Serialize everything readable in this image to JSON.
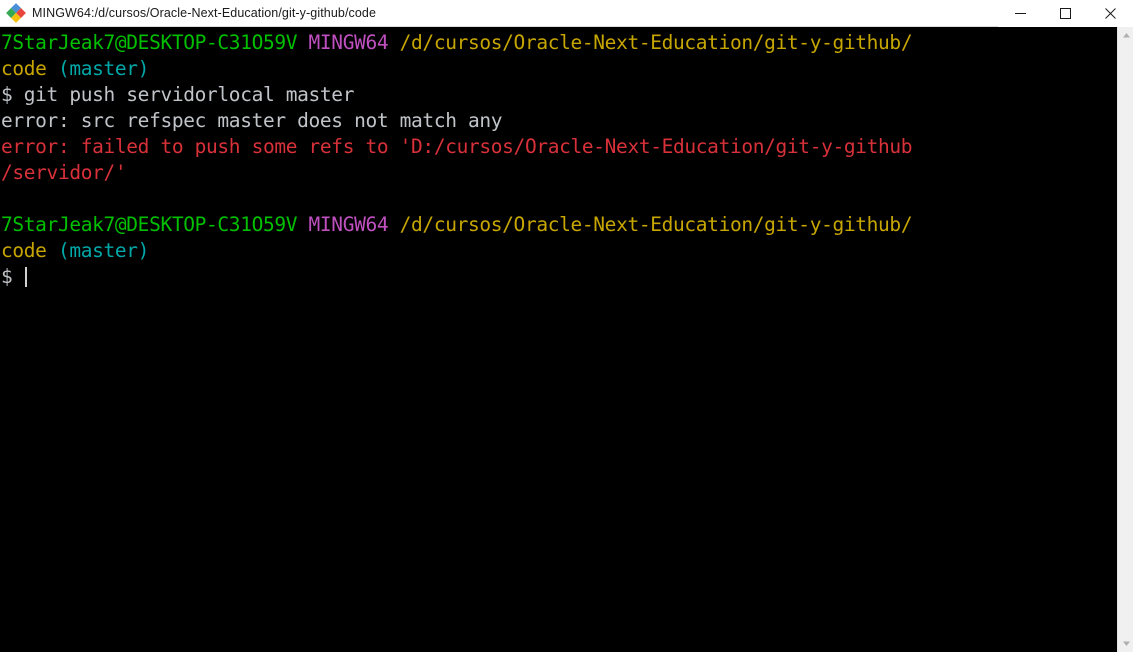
{
  "window": {
    "title": "MINGW64:/d/cursos/Oracle-Next-Education/git-y-github/code",
    "icon": "git-bash-diamond-icon",
    "controls": {
      "minimize": "minimize-icon",
      "maximize": "maximize-icon",
      "close": "close-icon"
    }
  },
  "theme": {
    "background": "#000000",
    "titlebar_background": "#ffffff",
    "foreground": "#c0c4c8",
    "green": "#00a000",
    "magenta": "#c050c0",
    "yellow": "#c7a600",
    "cyan": "#00a8a8",
    "red": "#d8313a",
    "scrollbar": "#f0f0f0"
  },
  "terminal": {
    "prompt": {
      "user_host": "7StarJeak7@DESKTOP-C31O59V",
      "shell": "MINGW64",
      "path_line1": "/d/cursos/Oracle-Next-Education/git-y-github/",
      "path_line2": "code",
      "branch": "(master)",
      "symbol": "$"
    },
    "lines": [
      {
        "id": "prompt-1a",
        "segments": [
          {
            "text": "7StarJeak7@DESKTOP-C31O59V",
            "color": "green"
          },
          {
            "text": " ",
            "color": "text"
          },
          {
            "text": "MINGW64",
            "color": "mingw"
          },
          {
            "text": " ",
            "color": "text"
          },
          {
            "text": "/d/cursos/Oracle-Next-Education/git-y-github/",
            "color": "path"
          }
        ]
      },
      {
        "id": "prompt-1b",
        "segments": [
          {
            "text": "code",
            "color": "path"
          },
          {
            "text": " ",
            "color": "text"
          },
          {
            "text": "(master)",
            "color": "branch"
          }
        ]
      },
      {
        "id": "command-1",
        "segments": [
          {
            "text": "$ git push servidorlocal master",
            "color": "text"
          }
        ]
      },
      {
        "id": "output-1",
        "segments": [
          {
            "text": "error: src refspec master does not match any",
            "color": "text"
          }
        ]
      },
      {
        "id": "output-2",
        "segments": [
          {
            "text": "error: failed to push some refs to 'D:/cursos/Oracle-Next-Education/git-y-github",
            "color": "err"
          }
        ]
      },
      {
        "id": "output-3",
        "segments": [
          {
            "text": "/servidor/'",
            "color": "err"
          }
        ]
      },
      {
        "id": "blank-1",
        "segments": [
          {
            "text": " ",
            "color": "text"
          }
        ]
      },
      {
        "id": "prompt-2a",
        "segments": [
          {
            "text": "7StarJeak7@DESKTOP-C31O59V",
            "color": "green"
          },
          {
            "text": " ",
            "color": "text"
          },
          {
            "text": "MINGW64",
            "color": "mingw"
          },
          {
            "text": " ",
            "color": "text"
          },
          {
            "text": "/d/cursos/Oracle-Next-Education/git-y-github/",
            "color": "path"
          }
        ]
      },
      {
        "id": "prompt-2b",
        "segments": [
          {
            "text": "code",
            "color": "path"
          },
          {
            "text": " ",
            "color": "text"
          },
          {
            "text": "(master)",
            "color": "branch"
          }
        ]
      },
      {
        "id": "prompt-2c",
        "segments": [
          {
            "text": "$ ",
            "color": "text"
          }
        ],
        "cursor": true
      }
    ]
  },
  "scrollbar": {
    "up_arrow": "chevron-up-icon",
    "down_arrow": "chevron-down-icon"
  }
}
